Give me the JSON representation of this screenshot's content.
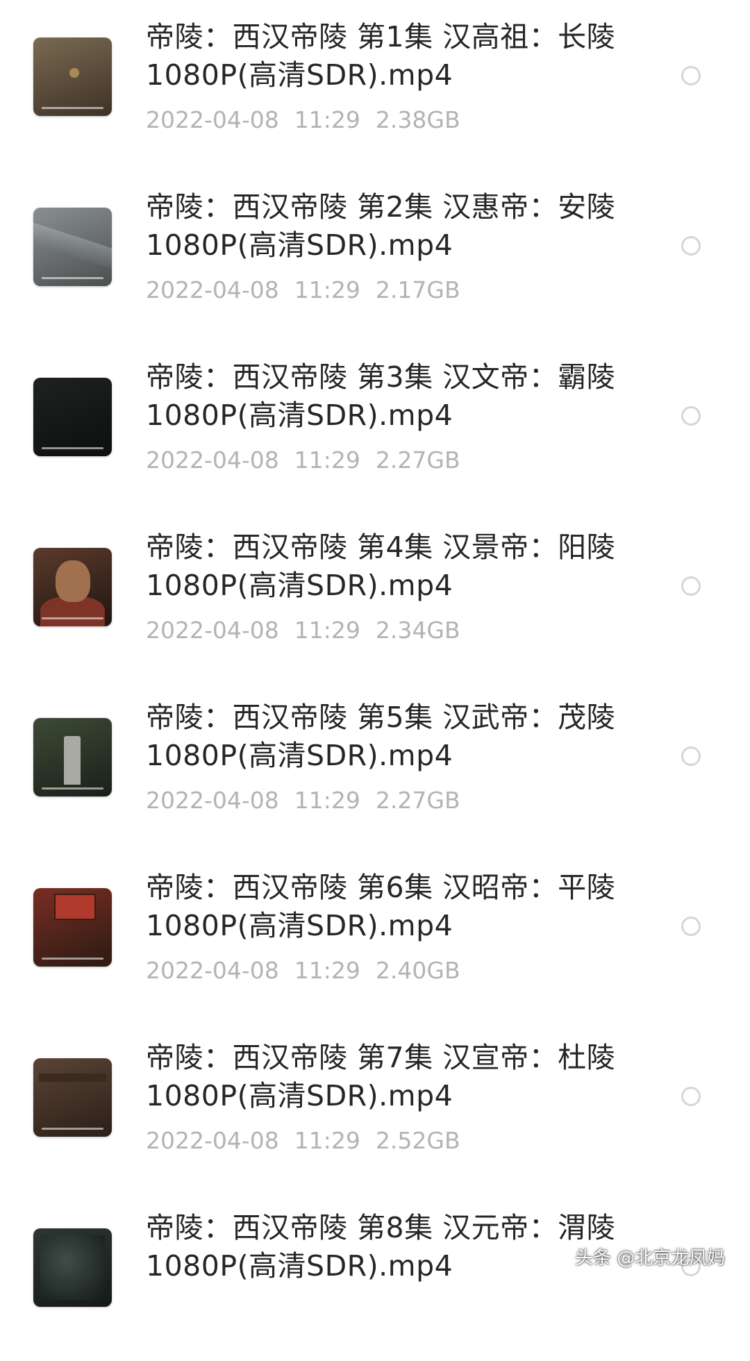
{
  "files": [
    {
      "name_line1": "帝陵：西汉帝陵 第1集 汉高祖：长陵",
      "name_line2": "1080P(高清SDR).mp4",
      "date": "2022-04-08",
      "time": "11:29",
      "size": "2.38GB",
      "thumbnail": "map-thumbnail",
      "thumb_colors": [
        "#7a6a52",
        "#3e3226"
      ]
    },
    {
      "name_line1": "帝陵：西汉帝陵 第2集 汉惠帝：安陵",
      "name_line2": "1080P(高清SDR).mp4",
      "date": "2022-04-08",
      "time": "11:29",
      "size": "2.17GB",
      "thumbnail": "city-wall-thumbnail",
      "thumb_colors": [
        "#8a8f93",
        "#4b4f4f"
      ]
    },
    {
      "name_line1": "帝陵：西汉帝陵 第3集 汉文帝：霸陵",
      "name_line2": "1080P(高清SDR).mp4",
      "date": "2022-04-08",
      "time": "11:29",
      "size": "2.27GB",
      "thumbnail": "dark-scene-thumbnail",
      "thumb_colors": [
        "#1d2220",
        "#0d0f0e"
      ]
    },
    {
      "name_line1": "帝陵：西汉帝陵 第4集 汉景帝：阳陵",
      "name_line2": "1080P(高清SDR).mp4",
      "date": "2022-04-08",
      "time": "11:29",
      "size": "2.34GB",
      "thumbnail": "emperor-portrait-thumbnail",
      "thumb_colors": [
        "#5b3b2c",
        "#1f1410"
      ]
    },
    {
      "name_line1": "帝陵：西汉帝陵 第5集 汉武帝：茂陵",
      "name_line2": "1080P(高清SDR).mp4",
      "date": "2022-04-08",
      "time": "11:29",
      "size": "2.27GB",
      "thumbnail": "stele-thumbnail",
      "thumb_colors": [
        "#3d4a36",
        "#1a2019"
      ]
    },
    {
      "name_line1": "帝陵：西汉帝陵 第6集 汉昭帝：平陵",
      "name_line2": "1080P(高清SDR).mp4",
      "date": "2022-04-08",
      "time": "11:29",
      "size": "2.40GB",
      "thumbnail": "palace-hall-thumbnail",
      "thumb_colors": [
        "#7a2e24",
        "#2a1a12"
      ]
    },
    {
      "name_line1": "帝陵：西汉帝陵 第7集 汉宣帝：杜陵",
      "name_line2": "1080P(高清SDR).mp4",
      "date": "2022-04-08",
      "time": "11:29",
      "size": "2.52GB",
      "thumbnail": "terracotta-thumbnail",
      "thumb_colors": [
        "#5a4436",
        "#2b1f18"
      ]
    },
    {
      "name_line1": "帝陵：西汉帝陵 第8集 汉元帝：渭陵",
      "name_line2": "1080P(高清SDR).mp4",
      "date": "",
      "time": "",
      "size": "",
      "thumbnail": "forest-thumbnail",
      "thumb_colors": [
        "#2d3633",
        "#141a18"
      ]
    }
  ],
  "watermark": "头条 @北京龙凤妈"
}
